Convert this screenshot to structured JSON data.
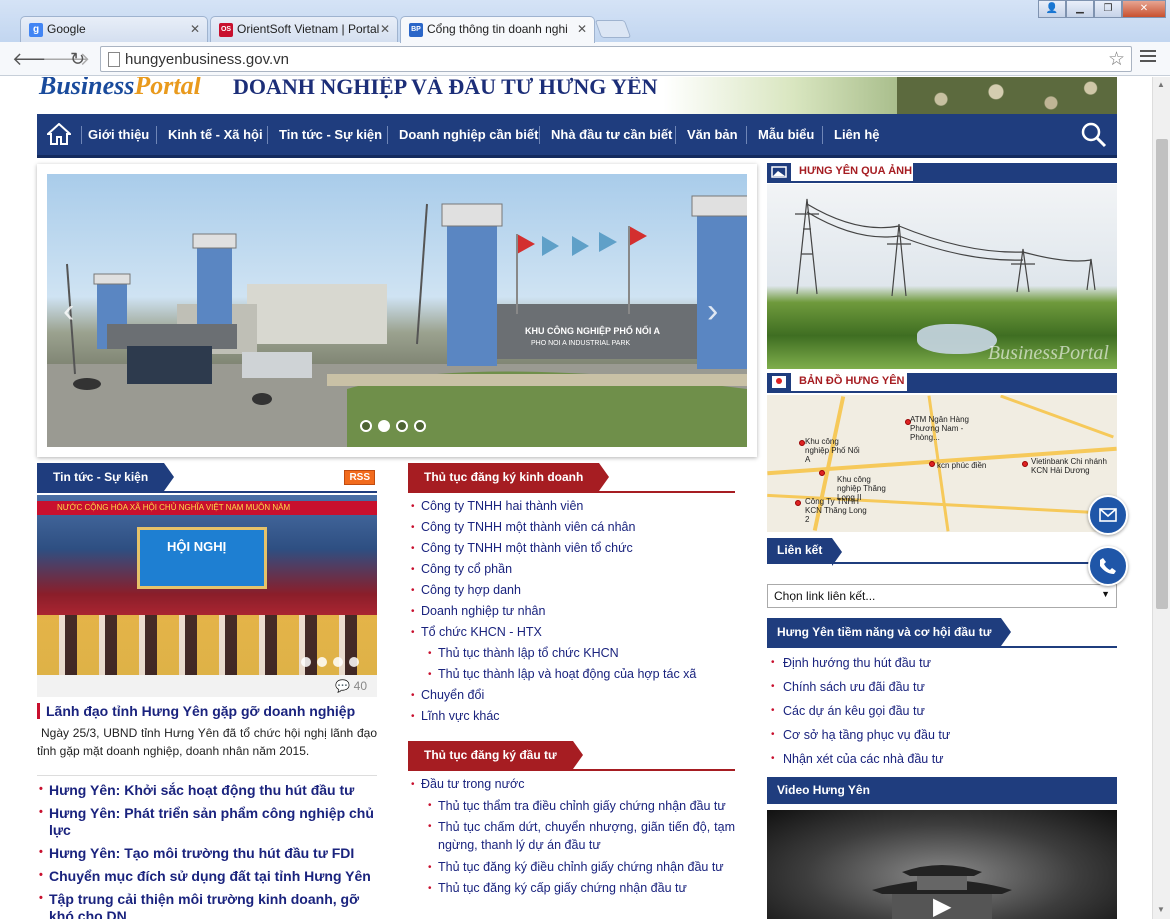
{
  "browser": {
    "tabs": [
      {
        "title": "Google",
        "icon": "google-icon",
        "color": "#4285f4",
        "glyph": "g"
      },
      {
        "title": "OrientSoft Vietnam | Portal",
        "icon": "orientsoft-icon",
        "color": "#c8102e",
        "glyph": "OS"
      },
      {
        "title": "Cổng thông tin doanh nghi",
        "icon": "businessportal-icon",
        "color": "#2a66c8",
        "glyph": "BP"
      }
    ],
    "url": "hungyenbusiness.gov.vn"
  },
  "banner": {
    "logo_business": "Business",
    "logo_portal": "Portal",
    "title": "DOANH NGHIỆP VÀ ĐẦU TƯ HƯNG YÊN"
  },
  "nav": {
    "items": [
      "Giới thiệu",
      "Kinh tế - Xã hội",
      "Tin tức - Sự kiện",
      "Doanh nghiệp cần biết",
      "Nhà đầu tư cần biết",
      "Văn bản",
      "Mẫu biểu",
      "Liên hệ"
    ]
  },
  "slider": {
    "sign_line1": "KHU CÔNG NGHIỆP PHỐ NỐI A",
    "sign_line2": "PHO NOI A INDUSTRIAL PARK",
    "dots": 4,
    "active_dot": 1
  },
  "news": {
    "header": "Tin tức - Sự kiện",
    "rss": "RSS",
    "image_banner": "NƯỚC CỘNG HÒA XÃ HỘI CHỦ NGHĨA VIỆT NAM MUÔN NĂM",
    "image_stage": "HỘI NGHỊ",
    "comments": "40",
    "title": "Lãnh đạo tỉnh Hưng Yên gặp gỡ doanh nghiệp",
    "summary": "Ngày 25/3, UBND tỉnh Hưng Yên đã tổ chức hội nghị lãnh đạo tỉnh gặp mặt doanh nghiệp, doanh nhân năm 2015.",
    "list": [
      "Hưng Yên: Khởi sắc hoạt động thu hút đầu tư",
      "Hưng Yên: Phát triển sản phẩm công nghiệp chủ lực",
      "Hưng Yên: Tạo môi trường thu hút đầu tư FDI",
      "Chuyển mục đích sử dụng đất tại tỉnh Hưng Yên",
      "Tập trung cải thiện môi trường kinh doanh, gỡ khó cho DN"
    ]
  },
  "business_reg": {
    "header": "Thủ tục đăng ký kinh doanh",
    "items": [
      {
        "label": "Công ty TNHH hai thành viên",
        "sub": false
      },
      {
        "label": "Công ty TNHH một thành viên cá nhân",
        "sub": false
      },
      {
        "label": "Công ty TNHH một thành viên tổ chức",
        "sub": false
      },
      {
        "label": "Công ty cổ phần",
        "sub": false
      },
      {
        "label": "Công ty hợp danh",
        "sub": false
      },
      {
        "label": "Doanh nghiệp tư nhân",
        "sub": false
      },
      {
        "label": "Tổ chức KHCN - HTX",
        "sub": false
      },
      {
        "label": "Thủ tục thành lập tổ chức KHCN",
        "sub": true
      },
      {
        "label": "Thủ tục thành lập và hoạt động của hợp tác xã",
        "sub": true
      },
      {
        "label": "Chuyển đổi",
        "sub": false
      },
      {
        "label": "Lĩnh vực khác",
        "sub": false
      }
    ]
  },
  "investment_reg": {
    "header": "Thủ tục đăng ký đầu tư",
    "items": [
      {
        "label": "Đầu tư trong nước",
        "sub": false
      },
      {
        "label": "Thủ tục thẩm tra điều chỉnh giấy chứng nhận đầu tư",
        "sub": true
      },
      {
        "label": "Thủ tục chấm dứt, chuyển nhượng, giãn tiến độ, tạm ngừng, thanh lý dự án đầu tư",
        "sub": true
      },
      {
        "label": "Thủ tục đăng ký điều chỉnh giấy chứng nhận đầu tư",
        "sub": true
      },
      {
        "label": "Thủ tục đăng ký cấp giấy chứng nhận đầu tư",
        "sub": true
      }
    ]
  },
  "right": {
    "photos_header": "HƯNG YÊN QUA ẢNH",
    "photo_watermark": "BusinessPortal",
    "map_header": "BẢN ĐỒ HƯNG YÊN",
    "map_labels": [
      "ATM Ngân Hàng Phương Nam - Phòng...",
      "Khu công nghiệp Phố Nối A",
      "Khu công nghiệp Thăng Long II",
      "kcn phúc điền",
      "Vietinbank Chi nhánh KCN Hải Dương",
      "Công Ty TNHH KCN Thăng Long 2"
    ],
    "links_header": "Liên kết",
    "links_placeholder": "Chọn link liên kết...",
    "invest_header": "Hưng Yên tiềm năng và cơ hội đầu tư",
    "invest_items": [
      "Định hướng thu hút đầu tư",
      "Chính sách ưu đãi đầu tư",
      "Các dự án kêu gọi đầu tư",
      "Cơ sở hạ tầng phục vụ đầu tư",
      "Nhận xét của các nhà đầu tư"
    ],
    "video_header": "Video Hưng Yên"
  },
  "colors": {
    "nav_blue": "#1f3d7e",
    "section_red": "#a61d22",
    "link_blue": "#1a237e",
    "bullet_red": "#c8102e"
  }
}
